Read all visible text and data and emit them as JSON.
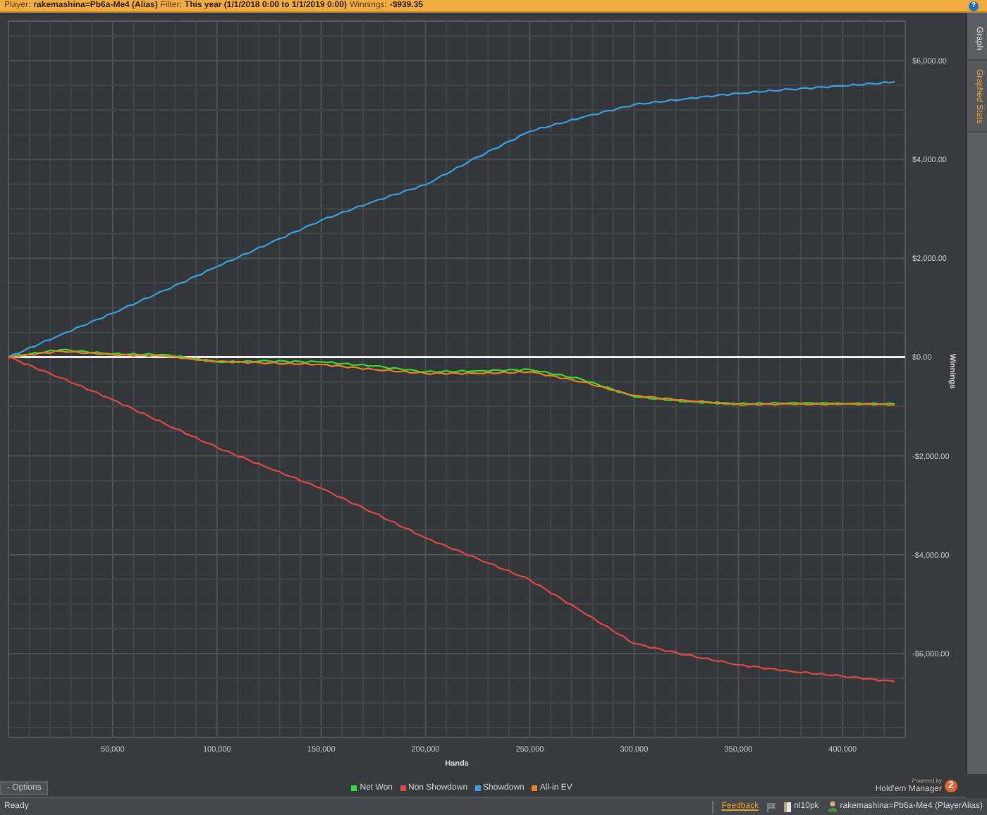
{
  "header": {
    "player_label": "Player:",
    "player": "rakemashina=Pb6a-Me4 (Alias)",
    "filter_label": "Filter:",
    "filter": "This year (1/1/2018 0:00 to 1/1/2019 0:00)",
    "winnings_label": "Winnings:",
    "winnings": "-$939.35",
    "help": "?"
  },
  "side_tabs": [
    {
      "label": "Graph",
      "selected": false
    },
    {
      "label": "Graphed Stats",
      "selected": true
    }
  ],
  "graph": {
    "chart_data": {
      "type": "line",
      "xlabel": "Hands",
      "ylabel": "Winnings",
      "x": [
        0,
        25000,
        50000,
        75000,
        100000,
        125000,
        150000,
        175000,
        200000,
        225000,
        250000,
        275000,
        300000,
        325000,
        350000,
        375000,
        400000,
        425000
      ],
      "series": [
        {
          "name": "Net Won",
          "color": "#33dd33",
          "values": [
            0,
            150,
            60,
            50,
            -100,
            -80,
            -100,
            -180,
            -300,
            -280,
            -250,
            -450,
            -800,
            -900,
            -950,
            -930,
            -940,
            -950
          ]
        },
        {
          "name": "Non Showdown",
          "color": "#e04848",
          "values": [
            0,
            -420,
            -860,
            -1350,
            -1830,
            -2250,
            -2660,
            -3150,
            -3660,
            -4080,
            -4510,
            -5150,
            -5800,
            -6030,
            -6230,
            -6360,
            -6460,
            -6570
          ]
        },
        {
          "name": "Showdown",
          "color": "#3aa0e0",
          "values": [
            0,
            450,
            890,
            1350,
            1830,
            2300,
            2770,
            3150,
            3490,
            4050,
            4570,
            4850,
            5110,
            5230,
            5340,
            5420,
            5490,
            5570
          ]
        },
        {
          "name": "All-in EV",
          "color": "#f08020",
          "values": [
            0,
            120,
            50,
            20,
            -90,
            -120,
            -150,
            -250,
            -330,
            -330,
            -300,
            -500,
            -780,
            -880,
            -960,
            -950,
            -950,
            -960
          ]
        }
      ],
      "grid": true,
      "xlim": [
        0,
        430000
      ],
      "ylim": [
        -7700,
        6800
      ],
      "xticks": [
        {
          "value": 50000,
          "label": "50,000"
        },
        {
          "value": 100000,
          "label": "100,000"
        },
        {
          "value": 150000,
          "label": "150,000"
        },
        {
          "value": 200000,
          "label": "200,000"
        },
        {
          "value": 250000,
          "label": "250,000"
        },
        {
          "value": 300000,
          "label": "300,000"
        },
        {
          "value": 350000,
          "label": "350,000"
        },
        {
          "value": 400000,
          "label": "400,000"
        }
      ],
      "yticks": [
        {
          "value": 6000,
          "label": "$6,000.00"
        },
        {
          "value": 4000,
          "label": "$4,000.00"
        },
        {
          "value": 2000,
          "label": "$2,000.00"
        },
        {
          "value": 0,
          "label": "$0.00"
        },
        {
          "value": -2000,
          "label": "-$2,000.00"
        },
        {
          "value": -4000,
          "label": "-$4,000.00"
        },
        {
          "value": -6000,
          "label": "-$6,000.00"
        }
      ]
    }
  },
  "options_button": {
    "icon": "-",
    "label": "Options"
  },
  "powered_by": {
    "caption": "Powered by",
    "product": "Hold'em Manager",
    "badge": "2"
  },
  "status_bar": {
    "text": "Ready",
    "feedback": "Feedback",
    "database": "nl10pk",
    "player": "rakemashina=Pb6a-Me4 (PlayerAlias)"
  }
}
